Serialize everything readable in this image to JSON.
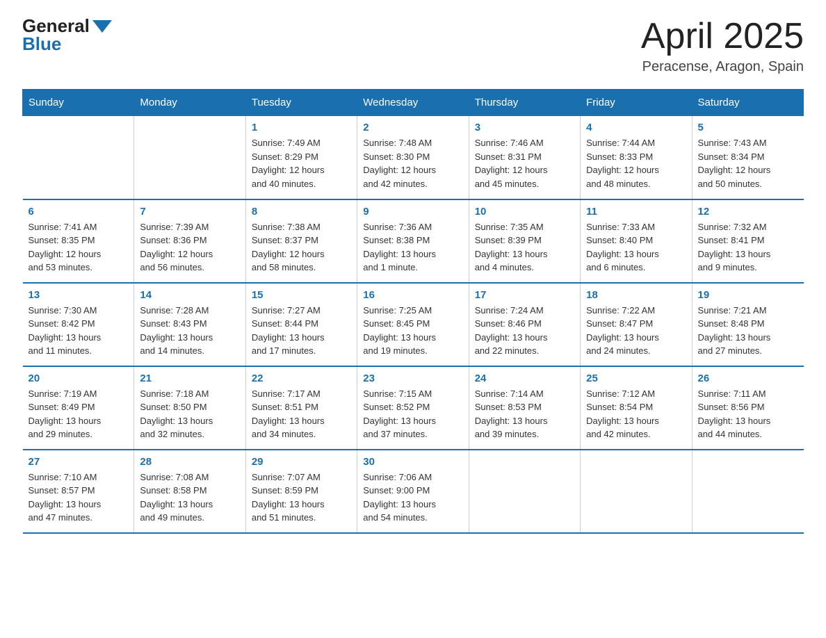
{
  "header": {
    "logo_general": "General",
    "logo_blue": "Blue",
    "title": "April 2025",
    "location": "Peracense, Aragon, Spain"
  },
  "days_of_week": [
    "Sunday",
    "Monday",
    "Tuesday",
    "Wednesday",
    "Thursday",
    "Friday",
    "Saturday"
  ],
  "weeks": [
    [
      {
        "day": "",
        "info": ""
      },
      {
        "day": "",
        "info": ""
      },
      {
        "day": "1",
        "info": "Sunrise: 7:49 AM\nSunset: 8:29 PM\nDaylight: 12 hours\nand 40 minutes."
      },
      {
        "day": "2",
        "info": "Sunrise: 7:48 AM\nSunset: 8:30 PM\nDaylight: 12 hours\nand 42 minutes."
      },
      {
        "day": "3",
        "info": "Sunrise: 7:46 AM\nSunset: 8:31 PM\nDaylight: 12 hours\nand 45 minutes."
      },
      {
        "day": "4",
        "info": "Sunrise: 7:44 AM\nSunset: 8:33 PM\nDaylight: 12 hours\nand 48 minutes."
      },
      {
        "day": "5",
        "info": "Sunrise: 7:43 AM\nSunset: 8:34 PM\nDaylight: 12 hours\nand 50 minutes."
      }
    ],
    [
      {
        "day": "6",
        "info": "Sunrise: 7:41 AM\nSunset: 8:35 PM\nDaylight: 12 hours\nand 53 minutes."
      },
      {
        "day": "7",
        "info": "Sunrise: 7:39 AM\nSunset: 8:36 PM\nDaylight: 12 hours\nand 56 minutes."
      },
      {
        "day": "8",
        "info": "Sunrise: 7:38 AM\nSunset: 8:37 PM\nDaylight: 12 hours\nand 58 minutes."
      },
      {
        "day": "9",
        "info": "Sunrise: 7:36 AM\nSunset: 8:38 PM\nDaylight: 13 hours\nand 1 minute."
      },
      {
        "day": "10",
        "info": "Sunrise: 7:35 AM\nSunset: 8:39 PM\nDaylight: 13 hours\nand 4 minutes."
      },
      {
        "day": "11",
        "info": "Sunrise: 7:33 AM\nSunset: 8:40 PM\nDaylight: 13 hours\nand 6 minutes."
      },
      {
        "day": "12",
        "info": "Sunrise: 7:32 AM\nSunset: 8:41 PM\nDaylight: 13 hours\nand 9 minutes."
      }
    ],
    [
      {
        "day": "13",
        "info": "Sunrise: 7:30 AM\nSunset: 8:42 PM\nDaylight: 13 hours\nand 11 minutes."
      },
      {
        "day": "14",
        "info": "Sunrise: 7:28 AM\nSunset: 8:43 PM\nDaylight: 13 hours\nand 14 minutes."
      },
      {
        "day": "15",
        "info": "Sunrise: 7:27 AM\nSunset: 8:44 PM\nDaylight: 13 hours\nand 17 minutes."
      },
      {
        "day": "16",
        "info": "Sunrise: 7:25 AM\nSunset: 8:45 PM\nDaylight: 13 hours\nand 19 minutes."
      },
      {
        "day": "17",
        "info": "Sunrise: 7:24 AM\nSunset: 8:46 PM\nDaylight: 13 hours\nand 22 minutes."
      },
      {
        "day": "18",
        "info": "Sunrise: 7:22 AM\nSunset: 8:47 PM\nDaylight: 13 hours\nand 24 minutes."
      },
      {
        "day": "19",
        "info": "Sunrise: 7:21 AM\nSunset: 8:48 PM\nDaylight: 13 hours\nand 27 minutes."
      }
    ],
    [
      {
        "day": "20",
        "info": "Sunrise: 7:19 AM\nSunset: 8:49 PM\nDaylight: 13 hours\nand 29 minutes."
      },
      {
        "day": "21",
        "info": "Sunrise: 7:18 AM\nSunset: 8:50 PM\nDaylight: 13 hours\nand 32 minutes."
      },
      {
        "day": "22",
        "info": "Sunrise: 7:17 AM\nSunset: 8:51 PM\nDaylight: 13 hours\nand 34 minutes."
      },
      {
        "day": "23",
        "info": "Sunrise: 7:15 AM\nSunset: 8:52 PM\nDaylight: 13 hours\nand 37 minutes."
      },
      {
        "day": "24",
        "info": "Sunrise: 7:14 AM\nSunset: 8:53 PM\nDaylight: 13 hours\nand 39 minutes."
      },
      {
        "day": "25",
        "info": "Sunrise: 7:12 AM\nSunset: 8:54 PM\nDaylight: 13 hours\nand 42 minutes."
      },
      {
        "day": "26",
        "info": "Sunrise: 7:11 AM\nSunset: 8:56 PM\nDaylight: 13 hours\nand 44 minutes."
      }
    ],
    [
      {
        "day": "27",
        "info": "Sunrise: 7:10 AM\nSunset: 8:57 PM\nDaylight: 13 hours\nand 47 minutes."
      },
      {
        "day": "28",
        "info": "Sunrise: 7:08 AM\nSunset: 8:58 PM\nDaylight: 13 hours\nand 49 minutes."
      },
      {
        "day": "29",
        "info": "Sunrise: 7:07 AM\nSunset: 8:59 PM\nDaylight: 13 hours\nand 51 minutes."
      },
      {
        "day": "30",
        "info": "Sunrise: 7:06 AM\nSunset: 9:00 PM\nDaylight: 13 hours\nand 54 minutes."
      },
      {
        "day": "",
        "info": ""
      },
      {
        "day": "",
        "info": ""
      },
      {
        "day": "",
        "info": ""
      }
    ]
  ]
}
